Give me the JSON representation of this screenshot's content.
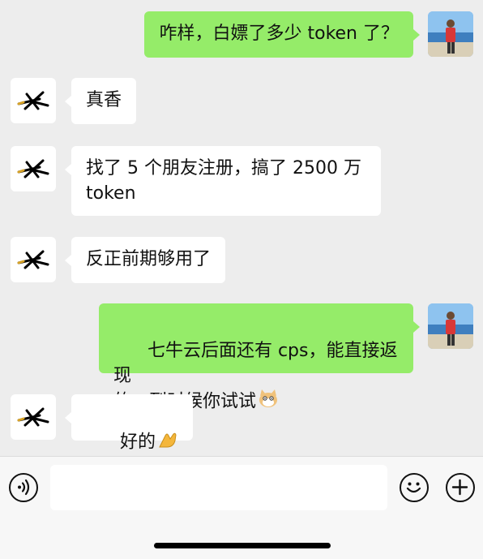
{
  "messages": [
    {
      "side": "right",
      "text": "咋样，白嫖了多少 token 了？"
    },
    {
      "side": "left",
      "text": "真香"
    },
    {
      "side": "left",
      "text": "找了 5 个朋友注册，搞了 2500 万\ntoken"
    },
    {
      "side": "left",
      "text": "反正前期够用了"
    },
    {
      "side": "right",
      "text": "七牛云后面还有 cps，能直接返现\n的，到时候你试试",
      "emoji": "cat-emoji"
    },
    {
      "side": "left",
      "text": "好的",
      "emoji": "ok-hand-emoji"
    }
  ],
  "input": {
    "value": "",
    "placeholder": ""
  },
  "colors": {
    "background": "#ededed",
    "bubble_me": "#95ec69",
    "bubble_other": "#ffffff"
  },
  "icons": [
    "voice-icon",
    "emoji-icon",
    "plus-icon"
  ]
}
